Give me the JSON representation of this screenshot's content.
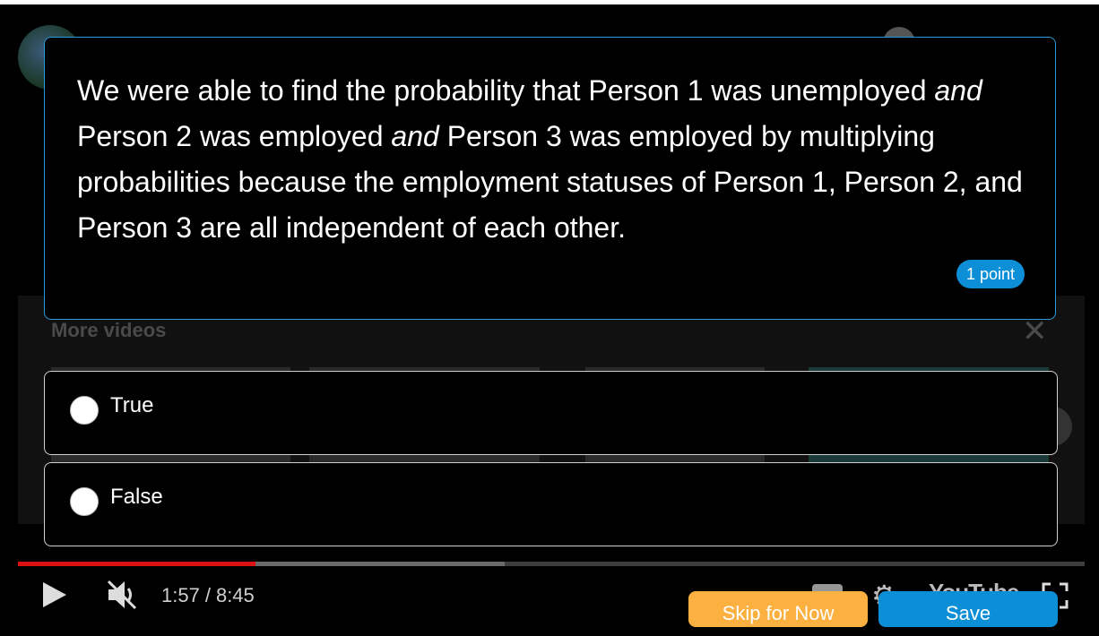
{
  "question": {
    "parts": [
      {
        "text": "We were able to find the probability that Person 1 was unemployed ",
        "italic": false
      },
      {
        "text": "and",
        "italic": true
      },
      {
        "text": " Person 2 was employed ",
        "italic": false
      },
      {
        "text": "and",
        "italic": true
      },
      {
        "text": " Person 3 was employed by multiplying probabilities because the employment statuses of Person 1, Person 2, and Person 3 are all independent of each other.",
        "italic": false
      }
    ],
    "points": "1 point"
  },
  "options": [
    {
      "label": "True",
      "selected": false
    },
    {
      "label": "False",
      "selected": false
    }
  ],
  "background": {
    "more_videos_title": "More videos",
    "youtube_logo": "YouTube"
  },
  "player": {
    "current_time": "1:57",
    "duration": "8:45",
    "progress_fraction": 0.223,
    "buffered_fraction": 0.456,
    "muted": true
  },
  "actions": {
    "skip_label": "Skip for Now",
    "save_label": "Save"
  },
  "colors": {
    "accent": "#0d8fd8",
    "skip": "#fbb040",
    "progress": "#dd1111"
  },
  "icons": [
    "play-icon",
    "mute-icon",
    "captions-icon",
    "settings-icon",
    "fullscreen-icon",
    "close-icon"
  ]
}
